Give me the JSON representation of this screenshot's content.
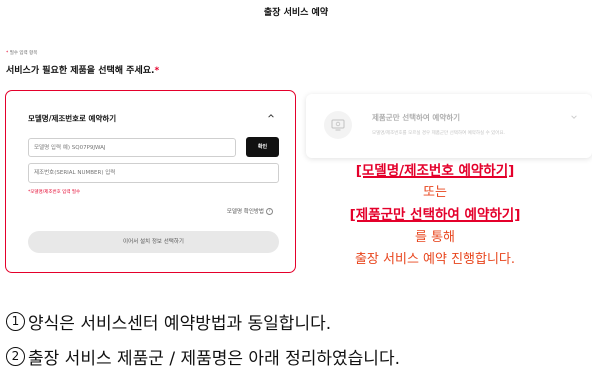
{
  "page": {
    "title": "출장 서비스 예약",
    "required_note_star": "*",
    "required_note": "필수 입력 항목",
    "section_heading": "서비스가 필요한 제품을 선택해 주세요.",
    "section_heading_star": "*"
  },
  "model_card": {
    "title": "모델명/제조번호로 예약하기",
    "model_input_placeholder": "모델명 입력 예) SQ07P9JWAJ",
    "confirm_button": "확인",
    "serial_input_placeholder": "제조번호(SERIAL NUMBER) 입력",
    "error_text": "*모델명/제조번호 입력 필수",
    "help_link": "모델명 확인방법",
    "help_icon_glyph": "?",
    "next_button": "이어서 설치 정보 선택하기",
    "accent_color": "#e4002b"
  },
  "category_card": {
    "title": "제품군만 선택하여 예약하기",
    "description": "모델명/제조번호를 모르실 경우 제품군만 선택하여 예약하실 수 있어요."
  },
  "annotation": {
    "line1": "[모델명/제조번호 예약하기]",
    "line2": "또는",
    "line3": "[제품군만 선택하여 예약하기]",
    "line4": "를 통해",
    "line5": "출장 서비스 예약 진행합니다.",
    "red_color": "#e4002b",
    "orange_color": "#e8461e"
  },
  "footer": {
    "item1_num": "1",
    "item1_text": "양식은 서비스센터 예약방법과 동일합니다.",
    "item2_num": "2",
    "item2_text": "출장 서비스 제품군 / 제품명은 아래 정리하였습니다."
  },
  "icons": {
    "model_card_chevron": "chevron-up-icon",
    "category_card_chevron": "chevron-down-icon",
    "category_icon": "monitor-icon",
    "help_icon": "question-circle-icon"
  }
}
